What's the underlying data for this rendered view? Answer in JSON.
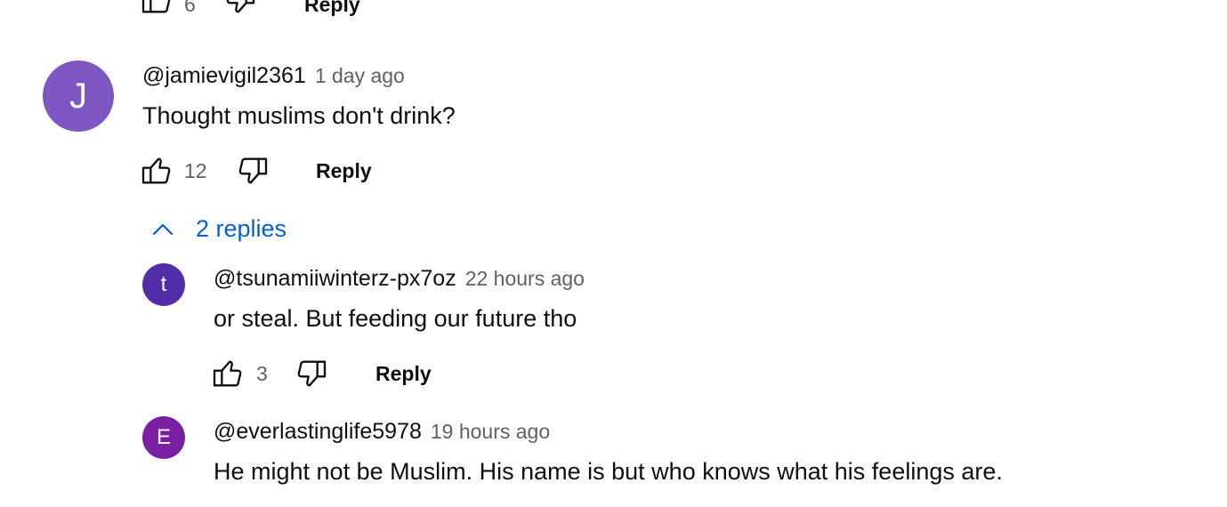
{
  "top_partial": {
    "likes": "6",
    "reply_label": "Reply"
  },
  "comment": {
    "avatar_letter": "J",
    "avatar_color": "#7e57c2",
    "author": "@jamievigil2361",
    "time": "1 day ago",
    "text": "Thought muslims don't drink?",
    "likes": "12",
    "reply_label": "Reply",
    "replies_toggle": "2 replies"
  },
  "replies": [
    {
      "avatar_letter": "t",
      "avatar_color": "#512da8",
      "author": "@tsunamiiwinterz-px7oz",
      "time": "22 hours ago",
      "text": "or steal. But feeding our future tho",
      "likes": "3",
      "reply_label": "Reply"
    },
    {
      "avatar_letter": "E",
      "avatar_color": "#7b1fa2",
      "author": "@everlastinglife5978",
      "time": "19 hours ago",
      "text": "He might not be Muslim. His name is but who knows what his feelings are."
    }
  ],
  "colors": {
    "link_blue": "#065fd4",
    "secondary_text": "#606060"
  },
  "icons": {
    "like": "thumbs-up-icon",
    "dislike": "thumbs-down-icon",
    "toggle": "chevron-up-icon"
  }
}
